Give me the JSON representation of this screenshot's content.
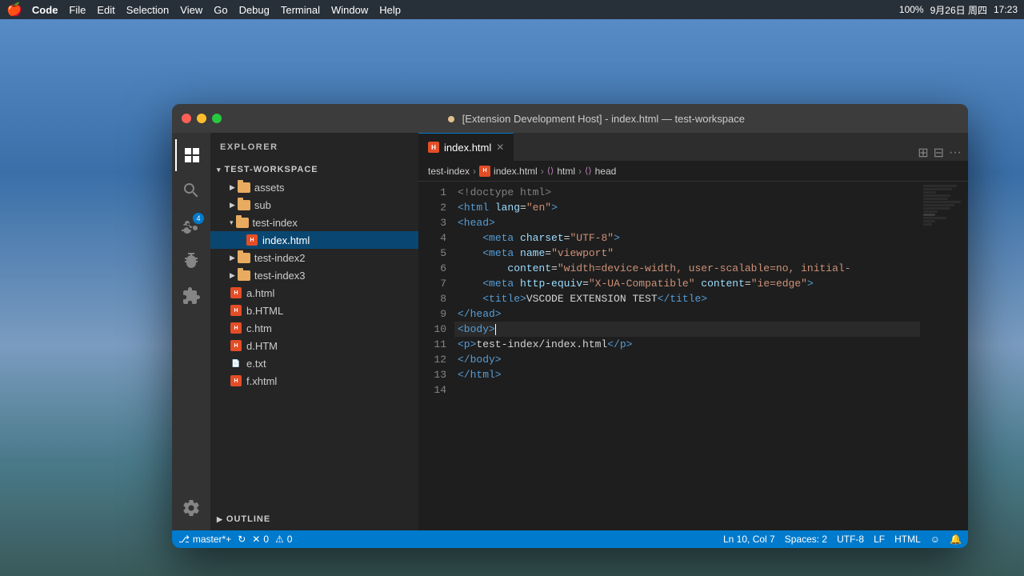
{
  "menubar": {
    "apple": "🍎",
    "app_name": "Code",
    "items": [
      "File",
      "Edit",
      "Selection",
      "View",
      "Go",
      "Debug",
      "Terminal",
      "Window",
      "Help"
    ],
    "right": {
      "battery": "100%",
      "date": "9月26日 周四",
      "time": "17:23"
    }
  },
  "window": {
    "title": "[Extension Development Host] - index.html — test-workspace"
  },
  "sidebar": {
    "section_header": "EXPLORER",
    "workspace_label": "TEST-WORKSPACE",
    "tree": [
      {
        "name": "assets",
        "type": "folder",
        "level": 1,
        "expanded": false
      },
      {
        "name": "sub",
        "type": "folder",
        "level": 1,
        "expanded": false
      },
      {
        "name": "test-index",
        "type": "folder",
        "level": 1,
        "expanded": true
      },
      {
        "name": "index.html",
        "type": "html",
        "level": 2,
        "active": true
      },
      {
        "name": "test-index2",
        "type": "folder",
        "level": 1,
        "expanded": false
      },
      {
        "name": "test-index3",
        "type": "folder",
        "level": 1,
        "expanded": false
      },
      {
        "name": "a.html",
        "type": "html",
        "level": 1
      },
      {
        "name": "b.HTML",
        "type": "html",
        "level": 1
      },
      {
        "name": "c.htm",
        "type": "html",
        "level": 1
      },
      {
        "name": "d.HTM",
        "type": "html",
        "level": 1
      },
      {
        "name": "e.txt",
        "type": "txt",
        "level": 1
      },
      {
        "name": "f.xhtml",
        "type": "html",
        "level": 1
      }
    ],
    "outline_label": "OUTLINE"
  },
  "tabs": [
    {
      "label": "index.html",
      "active": true,
      "modified": false
    }
  ],
  "breadcrumbs": [
    "test-index",
    "index.html",
    "html",
    "head"
  ],
  "editor": {
    "lines": [
      {
        "num": 1,
        "content": "<!doctype html>",
        "tokens": [
          {
            "text": "<!doctype html>",
            "class": "c-doctype"
          }
        ]
      },
      {
        "num": 2,
        "content": "<html lang=\"en\">",
        "tokens": [
          {
            "text": "<",
            "class": "c-tag"
          },
          {
            "text": "html",
            "class": "c-tag"
          },
          {
            "text": " lang",
            "class": "c-attr"
          },
          {
            "text": "=",
            "class": "c-text"
          },
          {
            "text": "\"en\"",
            "class": "c-string"
          },
          {
            "text": ">",
            "class": "c-tag"
          }
        ]
      },
      {
        "num": 3,
        "content": "<head>",
        "tokens": [
          {
            "text": "<head>",
            "class": "c-tag"
          }
        ]
      },
      {
        "num": 4,
        "content": "    <meta charset=\"UTF-8\">",
        "tokens": []
      },
      {
        "num": 5,
        "content": "    <meta name=\"viewport\"",
        "tokens": []
      },
      {
        "num": 6,
        "content": "        content=\"width=device-width, user-scalable=no, initial-",
        "tokens": []
      },
      {
        "num": 7,
        "content": "    <meta http-equiv=\"X-UA-Compatible\" content=\"ie=edge\">",
        "tokens": []
      },
      {
        "num": 8,
        "content": "    <title>VSCODE EXTENSION TEST</title>",
        "tokens": []
      },
      {
        "num": 9,
        "content": "</head>",
        "tokens": []
      },
      {
        "num": 10,
        "content": "<body>",
        "tokens": [],
        "active": true
      },
      {
        "num": 11,
        "content": "<p>test-index/index.html</p>",
        "tokens": []
      },
      {
        "num": 12,
        "content": "</body>",
        "tokens": []
      },
      {
        "num": 13,
        "content": "</html>",
        "tokens": []
      },
      {
        "num": 14,
        "content": "",
        "tokens": []
      }
    ]
  },
  "statusbar": {
    "branch_icon": "⎇",
    "branch": "master*+",
    "sync_icon": "↻",
    "error_icon": "✕",
    "errors": "0",
    "warning_icon": "⚠",
    "warnings": "0",
    "position": "Ln 10, Col 7",
    "spaces": "Spaces: 2",
    "encoding": "UTF-8",
    "line_ending": "LF",
    "language": "HTML",
    "smiley": "☺",
    "bell": "🔔"
  }
}
